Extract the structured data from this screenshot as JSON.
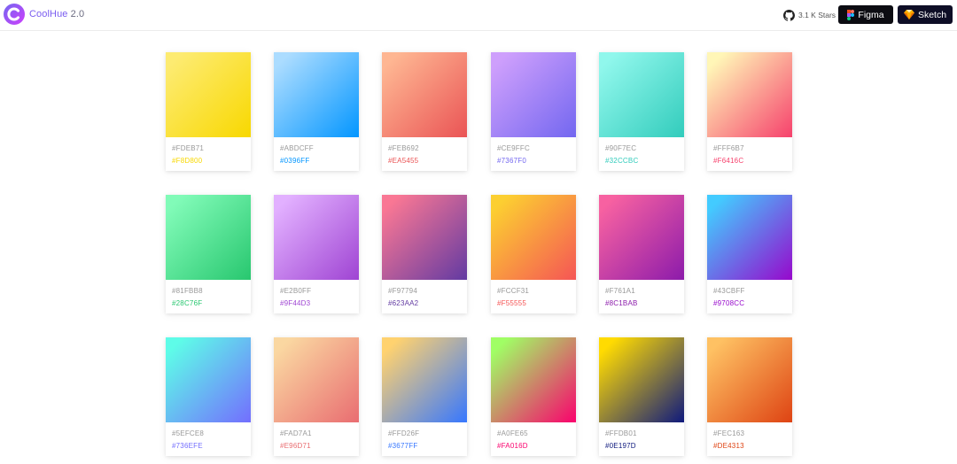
{
  "brand": {
    "name": "CoolHue",
    "version": "2.0"
  },
  "header": {
    "stars_label": "3.1 K Stars",
    "figma_label": "Figma",
    "sketch_label": "Sketch"
  },
  "gradients": [
    {
      "from": "#FDEB71",
      "to": "#F8D800"
    },
    {
      "from": "#ABDCFF",
      "to": "#0396FF"
    },
    {
      "from": "#FEB692",
      "to": "#EA5455"
    },
    {
      "from": "#CE9FFC",
      "to": "#7367F0"
    },
    {
      "from": "#90F7EC",
      "to": "#32CCBC"
    },
    {
      "from": "#FFF6B7",
      "to": "#F6416C"
    },
    {
      "from": "#81FBB8",
      "to": "#28C76F"
    },
    {
      "from": "#E2B0FF",
      "to": "#9F44D3"
    },
    {
      "from": "#F97794",
      "to": "#623AA2"
    },
    {
      "from": "#FCCF31",
      "to": "#F55555"
    },
    {
      "from": "#F761A1",
      "to": "#8C1BAB"
    },
    {
      "from": "#43CBFF",
      "to": "#9708CC"
    },
    {
      "from": "#5EFCE8",
      "to": "#736EFE"
    },
    {
      "from": "#FAD7A1",
      "to": "#E96D71"
    },
    {
      "from": "#FFD26F",
      "to": "#3677FF"
    },
    {
      "from": "#A0FE65",
      "to": "#FA016D"
    },
    {
      "from": "#FFDB01",
      "to": "#0E197D"
    },
    {
      "from": "#FEC163",
      "to": "#DE4313"
    }
  ]
}
